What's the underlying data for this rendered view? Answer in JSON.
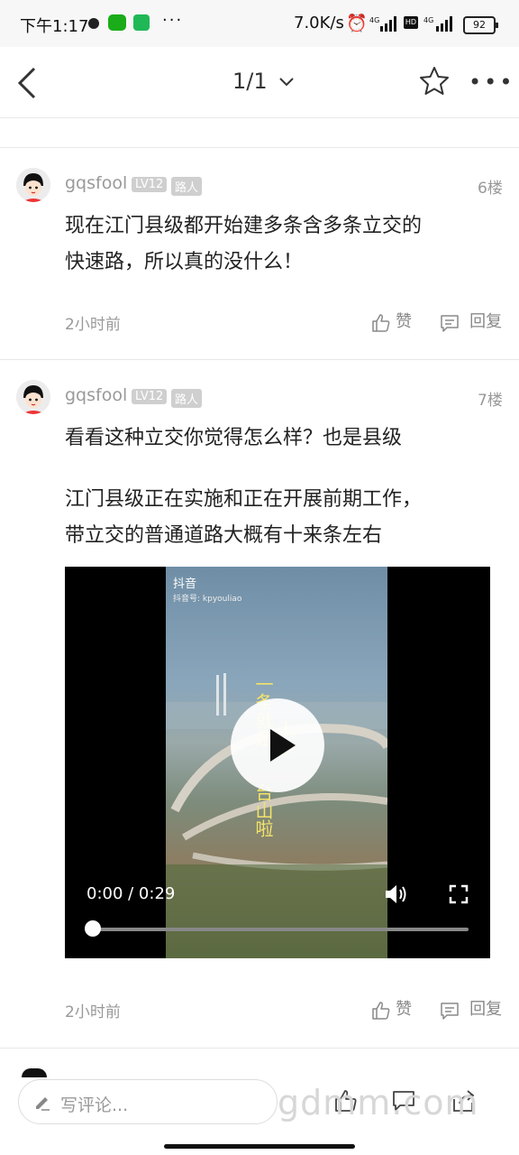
{
  "status_bar": {
    "time": "下午1:17",
    "more": "···",
    "speed": "7.0K/s",
    "hd": "HD",
    "battery": "92"
  },
  "topbar": {
    "page_indicator": "1/1"
  },
  "posts": [
    {
      "username": "gqsfool",
      "level": "LV12",
      "role": "路人",
      "floor": "6楼",
      "text_lines": [
        "现在江门县级都开始建多条含多条立交的",
        "快速路，所以真的没什么！"
      ],
      "time": "2小时前",
      "like_label": "赞",
      "reply_label": "回复"
    },
    {
      "username": "gqsfool",
      "level": "LV12",
      "role": "路人",
      "floor": "7楼",
      "text_lines": [
        "看看这种立交你觉得怎么样？也是县级",
        "",
        "江门县级正在实施和正在开展前期工作，",
        "带立交的普通道路大概有十来条左右"
      ],
      "time": "2小时前",
      "like_label": "赞",
      "reply_label": "回复",
      "video": {
        "current": "0:00",
        "duration": "0:29",
        "time_display": "0:00 / 0:29",
        "progress": 0,
        "brand": "抖音",
        "account": "抖音号: kpyouliao"
      }
    }
  ],
  "bottom": {
    "comment_placeholder": "写评论...",
    "watermark": "gdmm.com"
  }
}
